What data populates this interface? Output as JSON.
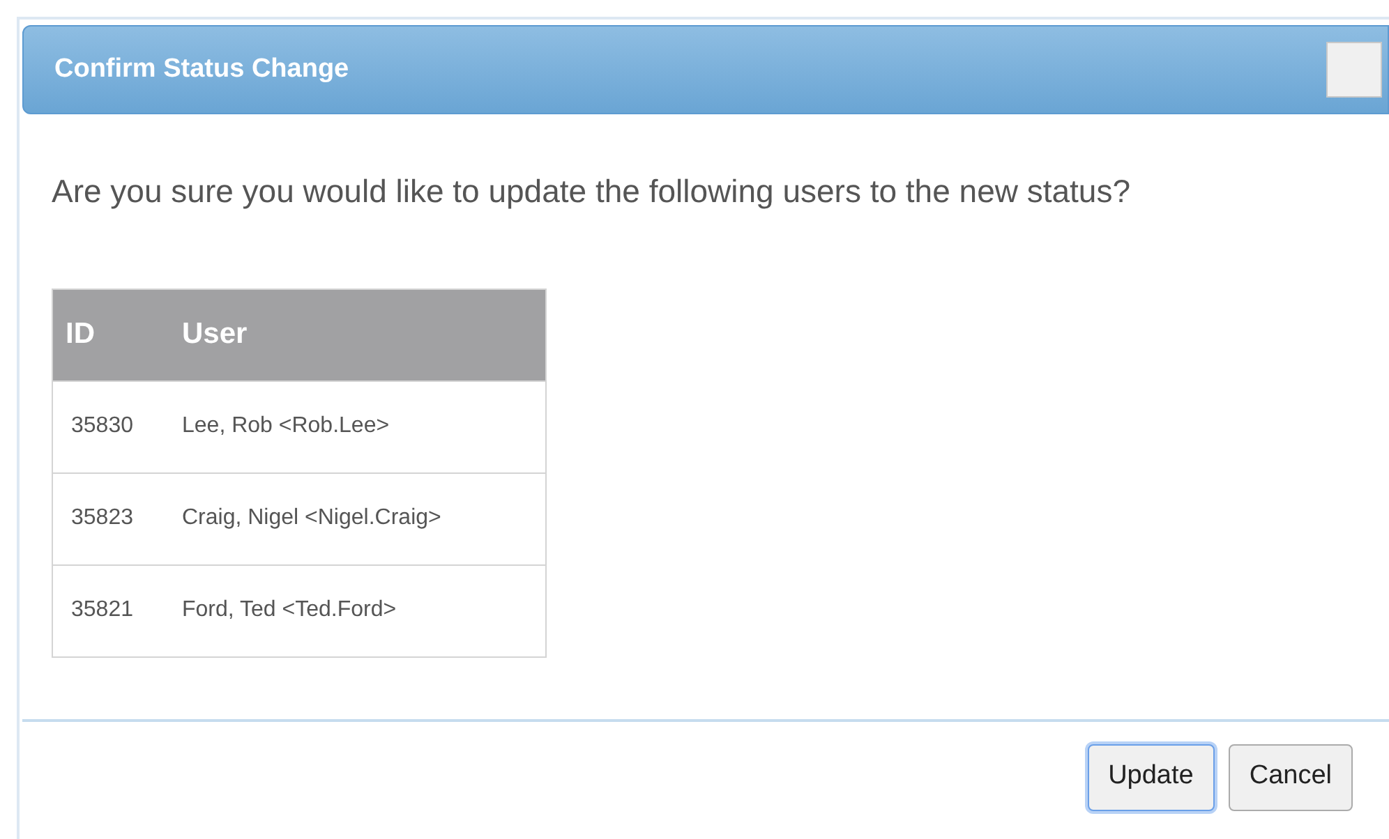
{
  "dialog": {
    "title": "Confirm Status Change",
    "message": "Are you sure you would like to update the following users to the new status?"
  },
  "table": {
    "columns": [
      "ID",
      "User"
    ],
    "rows": [
      {
        "id": "35830",
        "user": "Lee, Rob <Rob.Lee>"
      },
      {
        "id": "35823",
        "user": "Craig, Nigel <Nigel.Craig>"
      },
      {
        "id": "35821",
        "user": "Ford, Ted <Ted.Ford>"
      }
    ]
  },
  "buttons": [
    {
      "label": "Update",
      "focused": true
    },
    {
      "label": "Cancel",
      "focused": false
    }
  ]
}
